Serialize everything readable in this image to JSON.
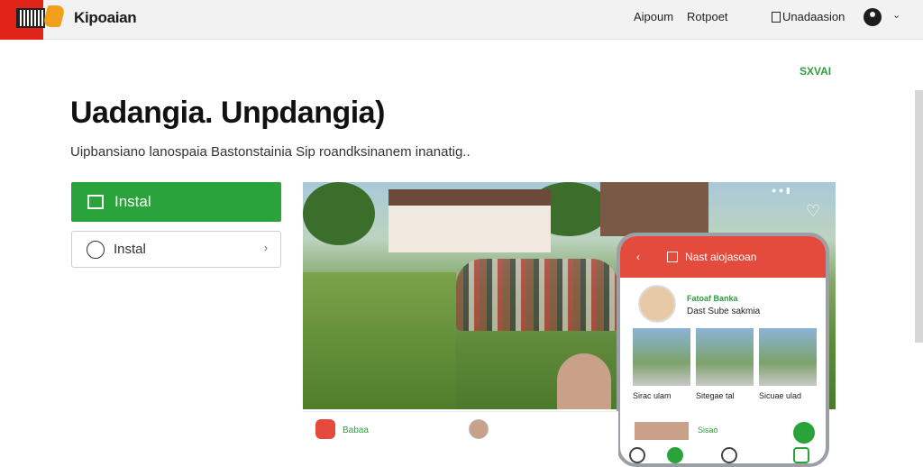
{
  "header": {
    "brand": "Kipoaian",
    "nav": [
      "Aipoum",
      "Rotpoet",
      "Unadaasion"
    ]
  },
  "corner_label": "SXVAI",
  "hero": {
    "title": "Uadangia. Unpdangia)",
    "subtitle": "Uipbansiano lanospaia Bastonstainia Sip roandksinanem inanatig.."
  },
  "buttons": {
    "primary_label": "Instal",
    "secondary_label": "Instal"
  },
  "phone": {
    "header_title": "Nast aiojasoan",
    "profile_name": "Fatoaf Banka",
    "profile_meta": "Dast Sube sakmia",
    "captions": [
      "Sirac ulam",
      "Sitegae tal",
      "Sicuae ulad"
    ],
    "tag": "Sisao"
  },
  "bottom": {
    "app_label": "Babaa"
  },
  "colors": {
    "accent_green": "#2aa33b",
    "phone_red": "#e54b3c",
    "logo_red": "#e2231a"
  }
}
